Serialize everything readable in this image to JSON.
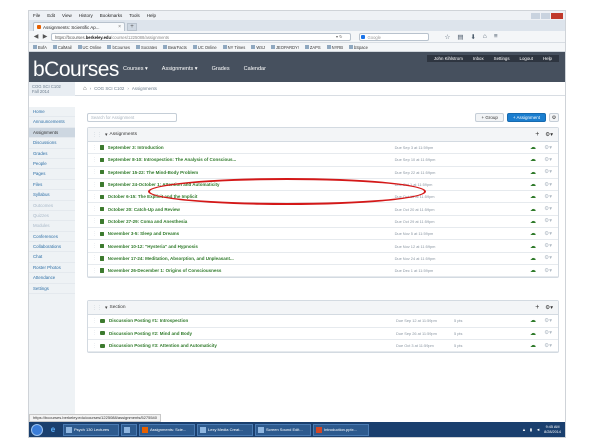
{
  "browser": {
    "menu": [
      "File",
      "Edit",
      "View",
      "History",
      "Bookmarks",
      "Tools",
      "Help"
    ],
    "tab_title": "Assignments: Scientific Ap...",
    "new_tab": "+",
    "url_prefix": "https://bcourses.",
    "url_domain": "berkeley.edu",
    "url_rest": "/courses/1225088/assignments",
    "search_placeholder": "Google",
    "bookmarks": [
      "BofA",
      "CalMail",
      "UC Online",
      "bCourses",
      "Socrates",
      "BearFacts",
      "UC Online",
      "NY Times",
      "WSJ",
      "JEOPARDY!",
      "ZAPS",
      "NYRB",
      "bSpace"
    ]
  },
  "canvas": {
    "logo": "bCourses",
    "nav": [
      "Courses",
      "Assignments",
      "Grades",
      "Calendar"
    ],
    "user_nav": [
      "John Kihlstrom",
      "Inbox",
      "Settings",
      "Logout",
      "Help"
    ],
    "course_code": [
      "COG SCI C102",
      "Fall 2014"
    ],
    "breadcrumb": [
      "COG SCI C102",
      "Assignments"
    ],
    "sidebar": [
      {
        "label": "Home",
        "state": "normal"
      },
      {
        "label": "Announcements",
        "state": "normal"
      },
      {
        "label": "Assignments",
        "state": "active"
      },
      {
        "label": "Discussions",
        "state": "normal"
      },
      {
        "label": "Grades",
        "state": "normal"
      },
      {
        "label": "People",
        "state": "normal"
      },
      {
        "label": "Pages",
        "state": "normal"
      },
      {
        "label": "Files",
        "state": "normal"
      },
      {
        "label": "Syllabus",
        "state": "normal"
      },
      {
        "label": "Outcomes",
        "state": "disabled"
      },
      {
        "label": "Quizzes",
        "state": "disabled"
      },
      {
        "label": "Modules",
        "state": "disabled"
      },
      {
        "label": "Conferences",
        "state": "normal"
      },
      {
        "label": "Collaborations",
        "state": "normal"
      },
      {
        "label": "Chat",
        "state": "normal"
      },
      {
        "label": "Roster Photos",
        "state": "normal"
      },
      {
        "label": "Attendance",
        "state": "normal"
      },
      {
        "label": "Settings",
        "state": "normal"
      }
    ],
    "search_placeholder": "Search for Assignment",
    "group_button": "+ Group",
    "assignment_button": "+ Assignment",
    "settings_icon": "gear-icon",
    "groups": [
      {
        "title": "Assignments",
        "rows": [
          {
            "title": "September 3: Introduction",
            "due": "Due Sep 3 at 11:59pm",
            "pts": ""
          },
          {
            "title": "September 8-10: Introspection: The Analysis of Conscious...",
            "due": "Due Sep 10 at 11:59pm",
            "pts": ""
          },
          {
            "title": "September 15-22: The Mind-Body Problem",
            "due": "Due Sep 22 at 11:59pm",
            "pts": ""
          },
          {
            "title": "September 24-October 1: Attention and Automaticity",
            "due": "Due Oct 1 at 11:59pm",
            "pts": ""
          },
          {
            "title": "October 6-15: The Explicit and the Implicit",
            "due": "Due Oct 15 at 11:59pm",
            "pts": ""
          },
          {
            "title": "October 20: Catch-Up and Review",
            "due": "Due Oct 20 at 11:59pm",
            "pts": ""
          },
          {
            "title": "October 27-29: Coma and Anesthesia",
            "due": "Due Oct 29 at 11:59pm",
            "pts": ""
          },
          {
            "title": "November 3-5: Sleep and Dreams",
            "due": "Due Nov 5 at 11:59pm",
            "pts": ""
          },
          {
            "title": "November 10-12: \"Hysteria\" and Hypnosis",
            "due": "Due Nov 12 at 11:59pm",
            "pts": ""
          },
          {
            "title": "November 17-24: Meditation, Absorption, and Unpleasant...",
            "due": "Due Nov 24 at 11:59pm",
            "pts": ""
          },
          {
            "title": "November 26-December 1: Origins of Consciousness",
            "due": "Due Dec 1 at 11:59pm",
            "pts": ""
          }
        ]
      },
      {
        "title": "Section",
        "rows": [
          {
            "title": "Discussion Posting #1: Introspection",
            "due": "Due Sep 12 at 11:59pm",
            "pts": "5 pts"
          },
          {
            "title": "Discussion Posting #2: Mind and Body",
            "due": "Due Sep 26 at 11:59pm",
            "pts": "5 pts"
          },
          {
            "title": "Discussion Posting #3: Attention and Automaticity",
            "due": "Due Oct 3 at 11:59pm",
            "pts": "5 pts"
          }
        ]
      }
    ]
  },
  "status_url": "https://bcourses.berkeley.edu/courses/1225088/assignments/5275540",
  "taskbar": {
    "pinned": [
      "e"
    ],
    "tasks": [
      "Psych 130 Lectures",
      "",
      "Assignments: Scie...",
      "Lexy Media Creat...",
      "Screen Sound Edit...",
      "Introduction.pptx..."
    ],
    "time": "9:45 AM",
    "date": "8/28/2014"
  },
  "colors": {
    "header_bg": "#46505e",
    "accent_blue": "#1b7ecf",
    "assignment_green": "#2f7a2a",
    "annotation_red": "#d41818"
  }
}
